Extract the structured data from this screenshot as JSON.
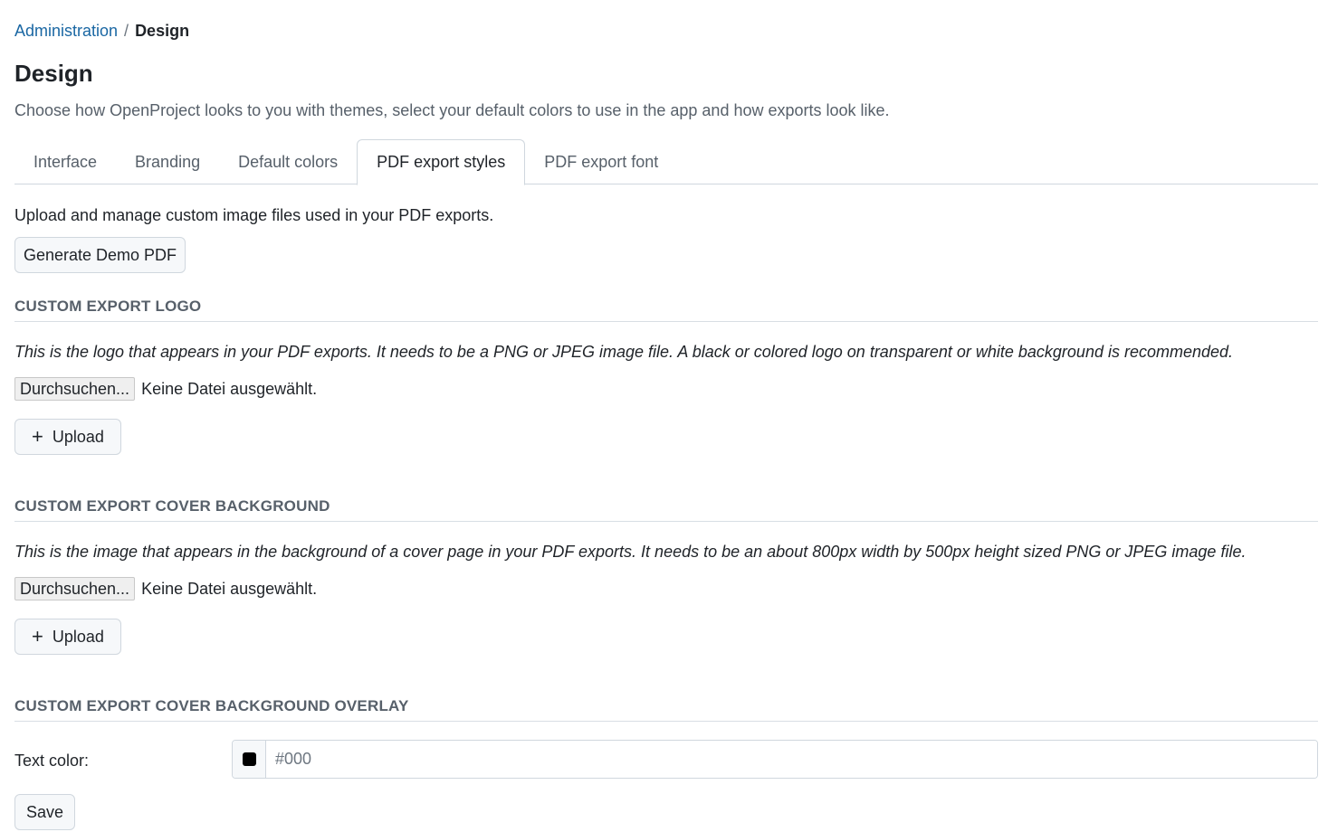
{
  "breadcrumb": {
    "parent": "Administration",
    "separator": "/",
    "current": "Design"
  },
  "header": {
    "title": "Design",
    "description": "Choose how OpenProject looks to you with themes, select your default colors to use in the app and how exports look like."
  },
  "tabs": [
    {
      "label": "Interface",
      "active": false
    },
    {
      "label": "Branding",
      "active": false
    },
    {
      "label": "Default colors",
      "active": false
    },
    {
      "label": "PDF export styles",
      "active": true
    },
    {
      "label": "PDF export font",
      "active": false
    }
  ],
  "main": {
    "intro": "Upload and manage custom image files used in your PDF exports.",
    "demo_button": "Generate Demo PDF",
    "logo_section": {
      "title": "CUSTOM EXPORT LOGO",
      "description": "This is the logo that appears in your PDF exports. It needs to be a PNG or JPEG image file. A black or colored logo on transparent or white background is recommended.",
      "browse_label": "Durchsuchen...",
      "file_status": "Keine Datei ausgewählt.",
      "upload_label": "Upload"
    },
    "cover_section": {
      "title": "CUSTOM EXPORT COVER BACKGROUND",
      "description": "This is the image that appears in the background of a cover page in your PDF exports. It needs to be an about 800px width by 500px height sized PNG or JPEG image file.",
      "browse_label": "Durchsuchen...",
      "file_status": "Keine Datei ausgewählt.",
      "upload_label": "Upload"
    },
    "overlay_section": {
      "title": "CUSTOM EXPORT COVER BACKGROUND OVERLAY",
      "text_color_label": "Text color:",
      "text_color_placeholder": "#000",
      "swatch_color": "#000000",
      "save_label": "Save"
    }
  },
  "colors": {
    "link": "#1a67a3",
    "border": "#d0d7de",
    "muted_text": "#57606a"
  }
}
